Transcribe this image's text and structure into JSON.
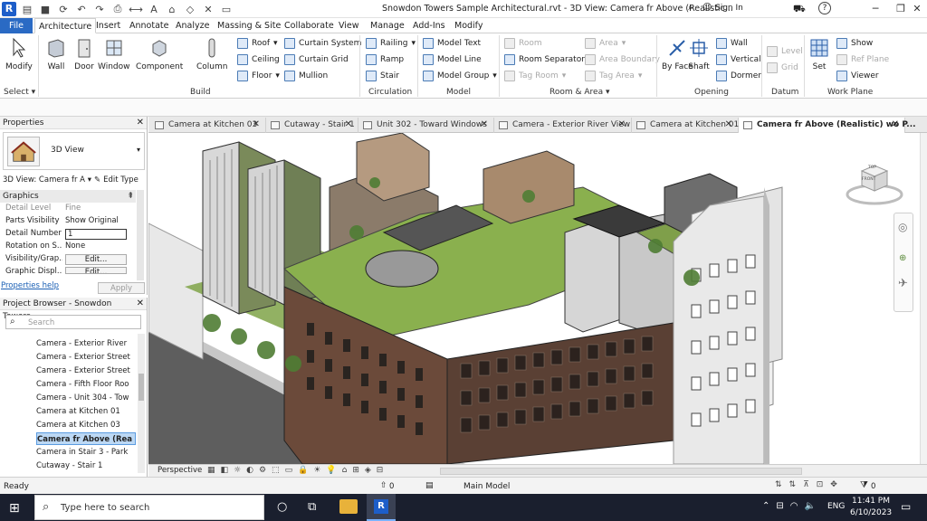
{
  "titlebar": {
    "title": "Snowdon Towers Sample Architectural.rvt - 3D View: Camera fr Above (Realistic...",
    "sign_in": "Sign In",
    "logo": "R",
    "help": "?"
  },
  "ribbon_tabs": [
    "File",
    "Architecture",
    "Insert",
    "Annotate",
    "Analyze",
    "Massing & Site",
    "Collaborate",
    "View",
    "Manage",
    "Add-Ins",
    "Modify"
  ],
  "active_tab": "Architecture",
  "ribbon": {
    "select": {
      "modify": "Modify",
      "panel": "Select"
    },
    "build": {
      "panel": "Build",
      "wall": "Wall",
      "door": "Door",
      "window": "Window",
      "component": "Component",
      "column": "Column",
      "roof": "Roof",
      "ceiling": "Ceiling",
      "floor": "Floor",
      "curtain_system": "Curtain System",
      "curtain_grid": "Curtain Grid",
      "mullion": "Mullion"
    },
    "circulation": {
      "panel": "Circulation",
      "railing": "Railing",
      "ramp": "Ramp",
      "stair": "Stair"
    },
    "model": {
      "panel": "Model",
      "model_text": "Model Text",
      "model_line": "Model Line",
      "model_group": "Model Group"
    },
    "room_area": {
      "panel": "Room & Area",
      "room": "Room",
      "room_separator": "Room Separator",
      "tag_room": "Tag Room",
      "area": "Area",
      "area_boundary": "Area Boundary",
      "tag_area": "Tag Area"
    },
    "opening": {
      "panel": "Opening",
      "by_face": "By Face",
      "shaft": "Shaft",
      "wall": "Wall",
      "vertical": "Vertical",
      "dormer": "Dormer"
    },
    "datum": {
      "panel": "Datum",
      "level": "Level",
      "grid": "Grid"
    },
    "work_plane": {
      "panel": "Work Plane",
      "set": "Set",
      "show": "Show",
      "ref_plane": "Ref Plane",
      "viewer": "Viewer"
    }
  },
  "properties": {
    "title": "Properties",
    "type_name": "3D View",
    "selector": "3D View: Camera fr A",
    "edit_type": "Edit Type",
    "section": "Graphics",
    "rows": [
      {
        "k": "Detail Level",
        "v": "Fine"
      },
      {
        "k": "Parts Visibility",
        "v": "Show Original"
      },
      {
        "k": "Detail Number",
        "v": "1"
      },
      {
        "k": "Rotation on S...",
        "v": "None"
      },
      {
        "k": "Visibility/Grap...",
        "v": "Edit..."
      },
      {
        "k": "Graphic Displ...",
        "v": "Edit..."
      }
    ],
    "help": "Properties help",
    "apply": "Apply"
  },
  "browser": {
    "title": "Project Browser - Snowdon Towers...",
    "search_placeholder": "Search",
    "items": [
      {
        "label": "Camera - Exterior River",
        "dash": false
      },
      {
        "label": "Camera - Exterior Street",
        "dash": true
      },
      {
        "label": "Camera - Exterior Street",
        "dash": false
      },
      {
        "label": "Camera - Fifth Floor Roo",
        "dash": false
      },
      {
        "label": "Camera - Unit 304 - Tow",
        "dash": false
      },
      {
        "label": "Camera at Kitchen 01",
        "dash": false
      },
      {
        "label": "Camera at Kitchen 03",
        "dash": false
      },
      {
        "label": "Camera fr Above (Rea",
        "dash": false,
        "selected": true
      },
      {
        "label": "Camera in Stair 3 - Park",
        "dash": false
      },
      {
        "label": "Cutaway - Stair 1",
        "dash": false
      }
    ]
  },
  "view_tabs": [
    "Camera at Kitchen 03",
    "Cutaway - Stair 1",
    "Unit 302 - Toward Windows",
    "Camera - Exterior River View",
    "Camera at Kitchen 01",
    "Camera fr Above (Realistic) wo P..."
  ],
  "viewcube": {
    "top": "TOP",
    "front": "FRONT"
  },
  "view_bar": {
    "label": "Perspective"
  },
  "status": {
    "text": "Ready",
    "workset": "0",
    "model": "Main Model",
    "filter": "0"
  },
  "taskbar": {
    "search_placeholder": "Type here to search",
    "lang": "ENG",
    "time": "11:41 PM",
    "date": "6/10/2023",
    "revit": "R"
  },
  "colors": {
    "accent": "#2a6ac4",
    "taskbar": "#1a1f2e",
    "grass": "#7fa348",
    "brick": "#6b4a3a"
  }
}
